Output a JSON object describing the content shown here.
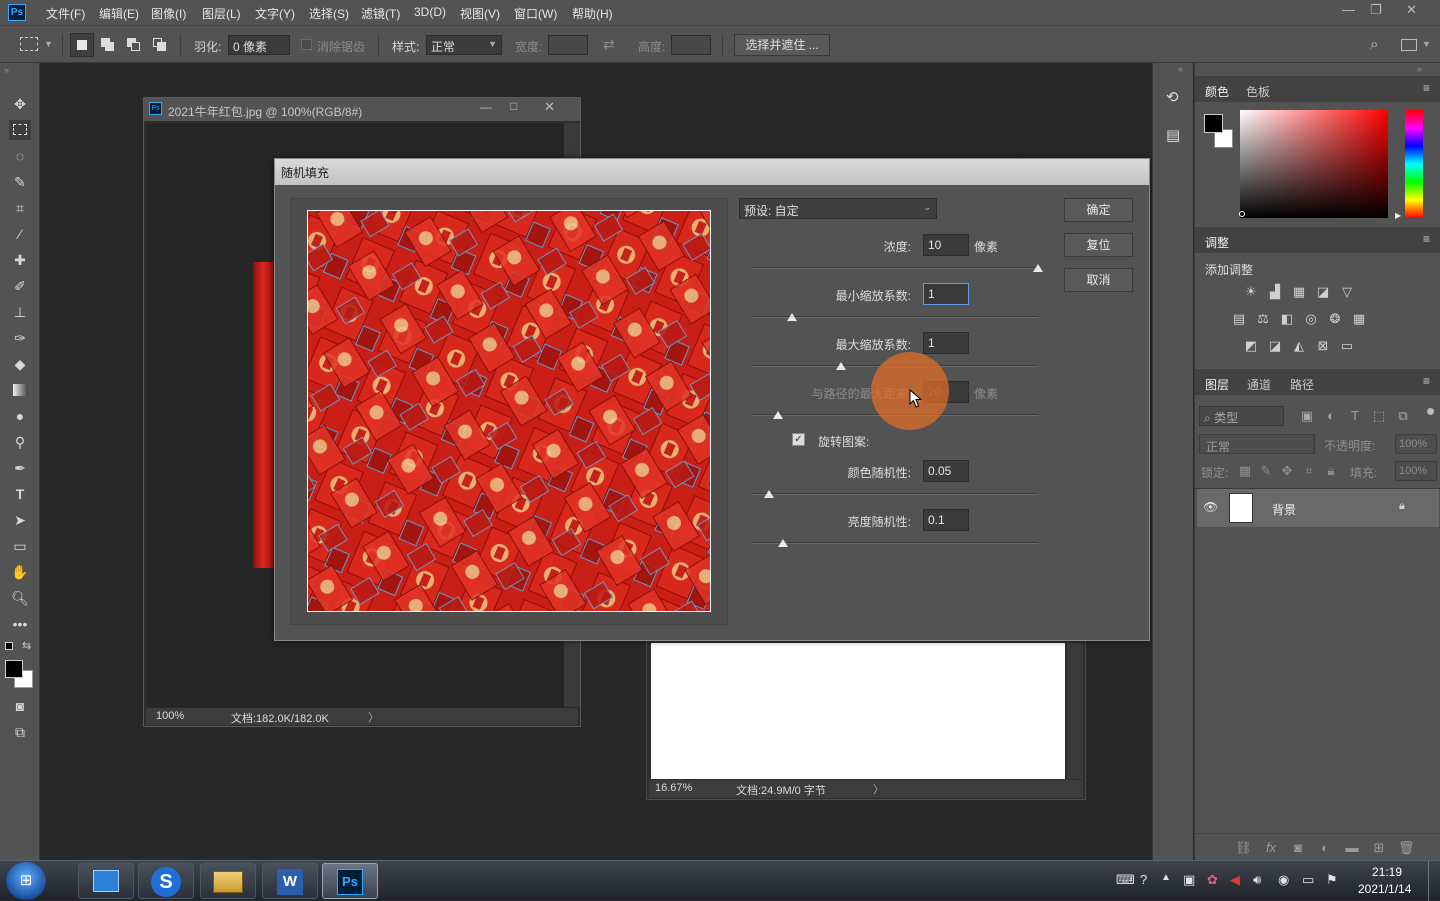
{
  "menubar": {
    "app_icon": "Ps",
    "items": [
      "文件(F)",
      "编辑(E)",
      "图像(I)",
      "图层(L)",
      "文字(Y)",
      "选择(S)",
      "滤镜(T)",
      "3D(D)",
      "视图(V)",
      "窗口(W)",
      "帮助(H)"
    ],
    "window_controls": [
      "minimize-icon",
      "restore-icon",
      "close-icon"
    ]
  },
  "options": {
    "feather_label": "羽化:",
    "feather_value": "0 像素",
    "antialias_label": "消除锯齿",
    "style_label": "样式:",
    "style_value": "正常",
    "width_label": "宽度:",
    "height_label": "高度:",
    "select_mask_button": "选择并遮住 ..."
  },
  "doc1": {
    "title": "2021牛年红包.jpg @ 100%(RGB/8#)",
    "zoom": "100%",
    "doc_info": "文档:182.0K/182.0K"
  },
  "doc2": {
    "zoom": "16.67%",
    "doc_info": "文档:24.9M/0 字节"
  },
  "dialog": {
    "title": "随机填充",
    "preset_label": "预设: 自定",
    "density_label": "浓度:",
    "density_value": "10",
    "density_unit": "像素",
    "min_scale_label": "最小缩放系数:",
    "min_scale_value": "1",
    "max_scale_label": "最大缩放系数:",
    "max_scale_value": "1",
    "path_distance_label": "与路径的最大距离:",
    "path_distance_value": "20",
    "path_distance_unit": "像素",
    "rotate_label": "旋转图案:",
    "rotate_checked": true,
    "color_random_label": "颜色随机性:",
    "color_random_value": "0.05",
    "brightness_random_label": "亮度随机性:",
    "brightness_random_value": "0.1",
    "ok_button": "确定",
    "reset_button": "复位",
    "cancel_button": "取消",
    "slider_levels": {
      "density": 1.0,
      "min_scale": 0.14,
      "max_scale": 0.31,
      "path_distance": 0.09,
      "color_random": 0.06,
      "brightness_random": 0.11
    }
  },
  "color_panel": {
    "tabs": [
      "颜色",
      "色板"
    ],
    "foreground": "#000000",
    "background": "#ffffff"
  },
  "adjust_panel": {
    "tab": "调整",
    "add_label": "添加调整"
  },
  "layers_panel": {
    "tabs": [
      "图层",
      "通道",
      "路径"
    ],
    "filter_placeholder": "类型",
    "blend_mode": "正常",
    "opacity_label": "不透明度:",
    "opacity_value": "100%",
    "lock_label": "锁定:",
    "fill_label": "填充:",
    "fill_value": "100%",
    "layers": [
      {
        "name": "背景",
        "visible": true,
        "locked": true
      }
    ]
  },
  "taskbar": {
    "apps": [
      "windows-explorer-icon",
      "sogou-icon",
      "file-manager-icon",
      "word-icon",
      "photoshop-icon"
    ],
    "time": "21:19",
    "date": "2021/1/14"
  }
}
